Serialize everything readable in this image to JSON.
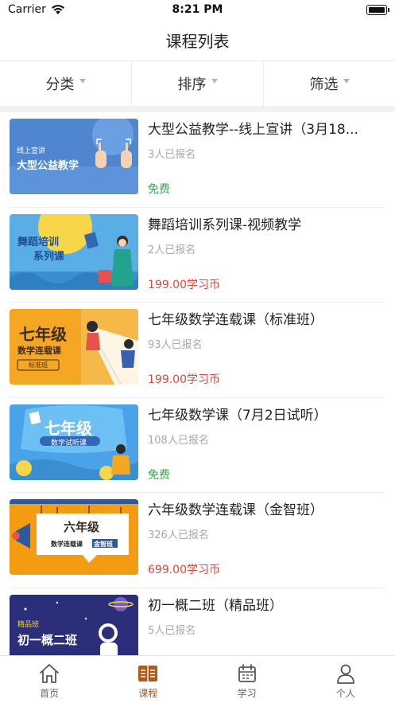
{
  "status_bar": {
    "carrier": "Carrier",
    "time": "8:21 PM"
  },
  "nav": {
    "title": "课程列表"
  },
  "filters": [
    {
      "label": "分类"
    },
    {
      "label": "排序"
    },
    {
      "label": "筛选"
    }
  ],
  "courses": [
    {
      "title": "大型公益教学--线上宣讲（3月18...",
      "enrolled": "3人已报名",
      "price": "免费",
      "thumb_tag": "线上宣讲",
      "thumb_title": "大型公益教学"
    },
    {
      "title": "舞蹈培训系列课-视频教学",
      "enrolled": "2人已报名",
      "price": "199.00学习币",
      "thumb_title_1": "舞蹈培训",
      "thumb_title_2": "系列课"
    },
    {
      "title": "七年级数学连载课（标准班）",
      "enrolled": "93人已报名",
      "price": "199.00学习币",
      "thumb_title": "七年级",
      "thumb_sub": "数学连载课",
      "thumb_badge": "标准班"
    },
    {
      "title": "七年级数学课（7月2日试听）",
      "enrolled": "108人已报名",
      "price": "免费",
      "thumb_title": "七年级",
      "thumb_sub": "数学试听课"
    },
    {
      "title": "六年级数学连载课（金智班）",
      "enrolled": "326人已报名",
      "price": "699.00学习币",
      "thumb_title": "六年级",
      "thumb_sub": "数学连载课",
      "thumb_badge": "金智班"
    },
    {
      "title": "初一概二班（精品班）",
      "enrolled": "5人已报名",
      "thumb_tag": "精品班",
      "thumb_title": "初一概二班"
    }
  ],
  "tabs": [
    {
      "label": "首页",
      "icon": "home-icon"
    },
    {
      "label": "课程",
      "icon": "course-book-icon",
      "active": true
    },
    {
      "label": "学习",
      "icon": "calendar-icon"
    },
    {
      "label": "个人",
      "icon": "person-icon"
    }
  ],
  "colors": {
    "free": "#3aa54f",
    "paid": "#e0463a",
    "active_tab": "#b05a1e",
    "muted": "#a8a8a8"
  }
}
